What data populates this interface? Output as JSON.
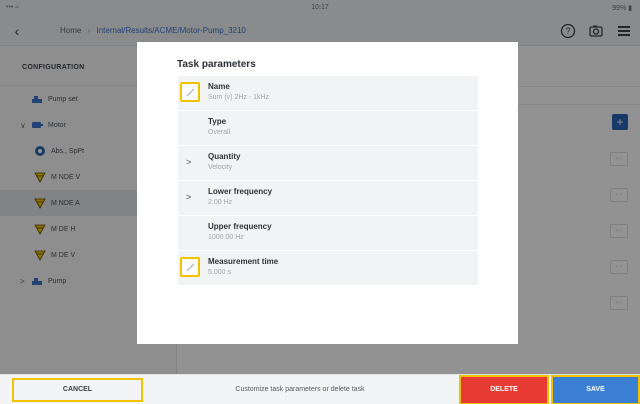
{
  "status": {
    "signal": "••• ≈",
    "time": "10:17",
    "battery": "99% ▮"
  },
  "nav": {
    "home_label": "Home",
    "separator": "›",
    "path": "Internal/Results/ACME/Motor-Pump_3210"
  },
  "sidebar": {
    "title": "CONFIGURATION",
    "items": [
      {
        "label": "Pump set",
        "icon": "machine-icon",
        "level": 1,
        "chevron": ""
      },
      {
        "label": "Motor",
        "icon": "motor-icon",
        "level": 1,
        "chevron": "∨"
      },
      {
        "label": "Abs., SpPt",
        "icon": "tacho-icon",
        "level": 2,
        "chevron": ""
      },
      {
        "label": "M NDE V",
        "icon": "sensor-icon",
        "level": 2,
        "chevron": ""
      },
      {
        "label": "M NDE A",
        "icon": "sensor-icon",
        "level": 2,
        "chevron": "",
        "selected": true
      },
      {
        "label": "M DE H",
        "icon": "sensor-icon",
        "level": 2,
        "chevron": ""
      },
      {
        "label": "M DE V",
        "icon": "sensor-icon",
        "level": 2,
        "chevron": ""
      },
      {
        "label": "Pump",
        "icon": "machine-icon",
        "level": 1,
        "chevron": ">"
      }
    ]
  },
  "main": {
    "more_label": "···",
    "plus_label": "+"
  },
  "dialog": {
    "title": "Task parameters",
    "params": [
      {
        "label": "Name",
        "value": "Sum (v) 2Hz - 1kHz",
        "control": "edit"
      },
      {
        "label": "Type",
        "value": "Overall",
        "control": "none"
      },
      {
        "label": "Quantity",
        "value": "Velocity",
        "control": "expand"
      },
      {
        "label": "Lower frequency",
        "value": "2.00 Hz",
        "control": "expand"
      },
      {
        "label": "Upper frequency",
        "value": "1000.00 Hz",
        "control": "none"
      },
      {
        "label": "Measurement time",
        "value": "5.000 s",
        "control": "edit"
      }
    ],
    "expand_glyph": ">"
  },
  "bottom": {
    "cancel_label": "CANCEL",
    "hint": "Customize task parameters or delete task",
    "delete_label": "DELETE",
    "save_label": "SAVE"
  },
  "colors": {
    "accent_yellow": "#f2c200",
    "delete_red": "#e63a33",
    "save_blue": "#3b7fd4",
    "primary_blue": "#2d63b8"
  }
}
